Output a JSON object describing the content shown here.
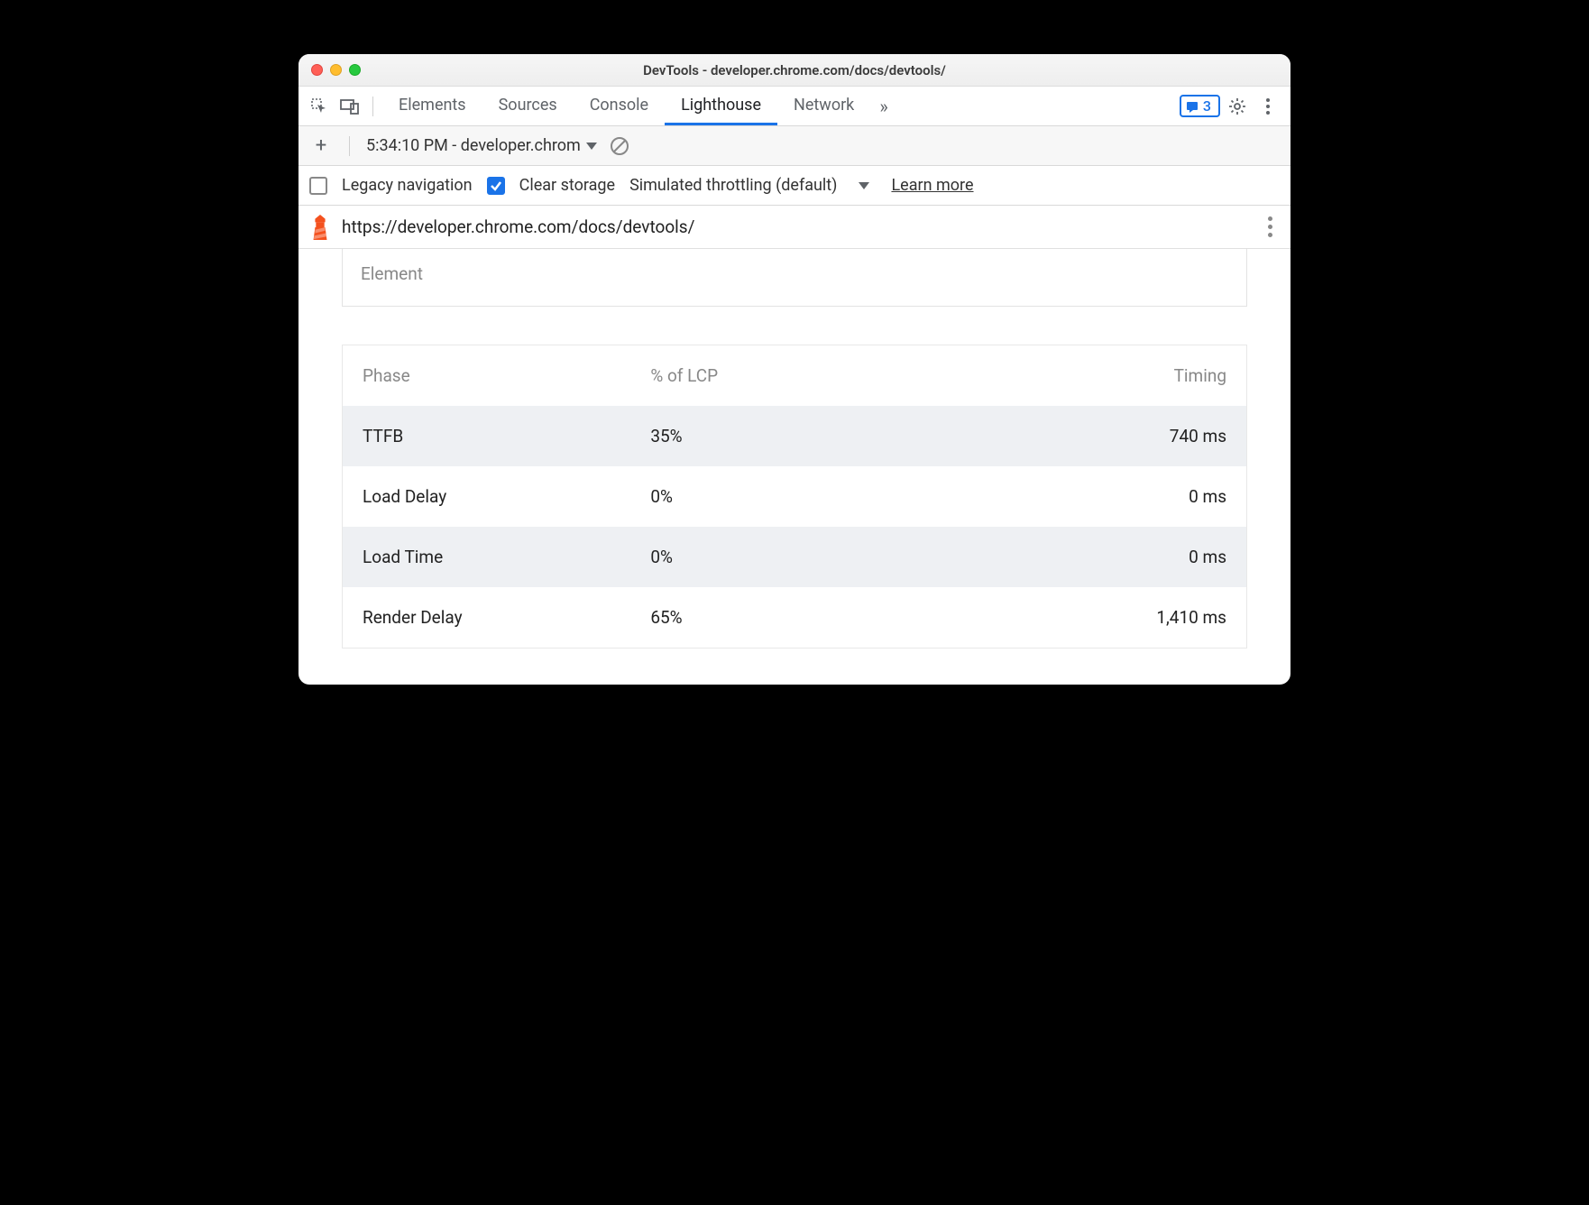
{
  "window": {
    "title": "DevTools - developer.chrome.com/docs/devtools/"
  },
  "tabs": {
    "items": [
      "Elements",
      "Sources",
      "Console",
      "Lighthouse",
      "Network"
    ],
    "active": "Lighthouse",
    "badge_count": "3"
  },
  "sub_toolbar": {
    "report_label": "5:34:10 PM - developer.chrom"
  },
  "options": {
    "legacy_navigation_label": "Legacy navigation",
    "clear_storage_label": "Clear storage",
    "throttling_label": "Simulated throttling (default)",
    "learn_more_label": "Learn more"
  },
  "url_bar": {
    "url": "https://developer.chrome.com/docs/devtools/"
  },
  "element_box": {
    "label": "Element"
  },
  "table": {
    "headers": {
      "phase": "Phase",
      "pct": "% of LCP",
      "timing": "Timing"
    },
    "rows": [
      {
        "phase": "TTFB",
        "pct": "35%",
        "timing": "740 ms"
      },
      {
        "phase": "Load Delay",
        "pct": "0%",
        "timing": "0 ms"
      },
      {
        "phase": "Load Time",
        "pct": "0%",
        "timing": "0 ms"
      },
      {
        "phase": "Render Delay",
        "pct": "65%",
        "timing": "1,410 ms"
      }
    ]
  }
}
